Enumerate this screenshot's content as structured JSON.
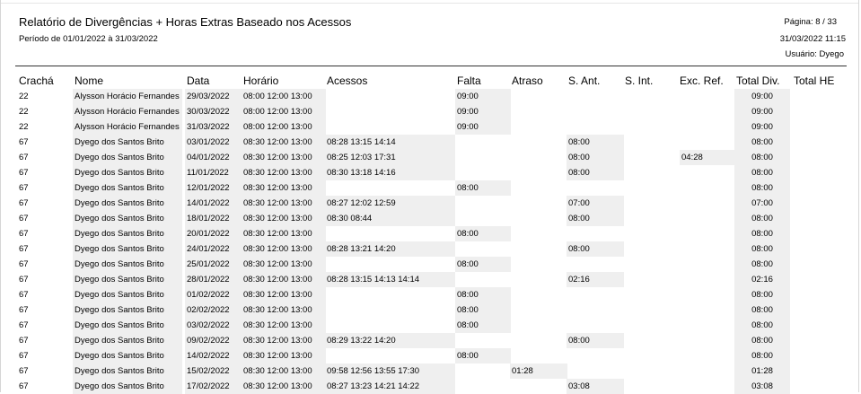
{
  "report": {
    "title": "Relatório de Divergências + Horas Extras Baseado nos Acessos",
    "period": "Período de 01/01/2022 à 31/03/2022",
    "page": "Página: 8 / 33",
    "datetime": "31/03/2022 11:15",
    "user": "Usuário: Dyego"
  },
  "columns": [
    "Crachá",
    "Nome",
    "Data",
    "Horário",
    "Acessos",
    "Falta",
    "Atraso",
    "S. Ant.",
    "S. Int.",
    "Exc. Ref.",
    "Total Div.",
    "Total HE"
  ],
  "rows": [
    {
      "cracha": "22",
      "nome": "Alysson Horácio Fernandes",
      "data": "29/03/2022",
      "horario": "08:00 12:00 13:00",
      "acessos": "",
      "falta": "09:00",
      "atraso": "",
      "sant": "",
      "sint": "",
      "excref": "",
      "totaldiv": "09:00",
      "totalhe": ""
    },
    {
      "cracha": "22",
      "nome": "Alysson Horácio Fernandes",
      "data": "30/03/2022",
      "horario": "08:00 12:00 13:00",
      "acessos": "",
      "falta": "09:00",
      "atraso": "",
      "sant": "",
      "sint": "",
      "excref": "",
      "totaldiv": "09:00",
      "totalhe": ""
    },
    {
      "cracha": "22",
      "nome": "Alysson Horácio Fernandes",
      "data": "31/03/2022",
      "horario": "08:00 12:00 13:00",
      "acessos": "",
      "falta": "09:00",
      "atraso": "",
      "sant": "",
      "sint": "",
      "excref": "",
      "totaldiv": "09:00",
      "totalhe": ""
    },
    {
      "cracha": "67",
      "nome": "Dyego dos Santos Brito",
      "data": "03/01/2022",
      "horario": "08:30 12:00 13:00",
      "acessos": "08:28 13:15 14:14",
      "falta": "",
      "atraso": "",
      "sant": "08:00",
      "sint": "",
      "excref": "",
      "totaldiv": "08:00",
      "totalhe": ""
    },
    {
      "cracha": "67",
      "nome": "Dyego dos Santos Brito",
      "data": "04/01/2022",
      "horario": "08:30 12:00 13:00",
      "acessos": "08:25 12:03 17:31",
      "falta": "",
      "atraso": "",
      "sant": "08:00",
      "sint": "",
      "excref": "04:28",
      "totaldiv": "08:00",
      "totalhe": ""
    },
    {
      "cracha": "67",
      "nome": "Dyego dos Santos Brito",
      "data": "11/01/2022",
      "horario": "08:30 12:00 13:00",
      "acessos": "08:30 13:18 14:16",
      "falta": "",
      "atraso": "",
      "sant": "08:00",
      "sint": "",
      "excref": "",
      "totaldiv": "08:00",
      "totalhe": ""
    },
    {
      "cracha": "67",
      "nome": "Dyego dos Santos Brito",
      "data": "12/01/2022",
      "horario": "08:30 12:00 13:00",
      "acessos": "",
      "falta": "08:00",
      "atraso": "",
      "sant": "",
      "sint": "",
      "excref": "",
      "totaldiv": "08:00",
      "totalhe": ""
    },
    {
      "cracha": "67",
      "nome": "Dyego dos Santos Brito",
      "data": "14/01/2022",
      "horario": "08:30 12:00 13:00",
      "acessos": "08:27 12:02 12:59",
      "falta": "",
      "atraso": "",
      "sant": "07:00",
      "sint": "",
      "excref": "",
      "totaldiv": "07:00",
      "totalhe": ""
    },
    {
      "cracha": "67",
      "nome": "Dyego dos Santos Brito",
      "data": "18/01/2022",
      "horario": "08:30 12:00 13:00",
      "acessos": "08:30  08:44",
      "falta": "",
      "atraso": "",
      "sant": "08:00",
      "sint": "",
      "excref": "",
      "totaldiv": "08:00",
      "totalhe": ""
    },
    {
      "cracha": "67",
      "nome": "Dyego dos Santos Brito",
      "data": "20/01/2022",
      "horario": "08:30 12:00 13:00",
      "acessos": "",
      "falta": "08:00",
      "atraso": "",
      "sant": "",
      "sint": "",
      "excref": "",
      "totaldiv": "08:00",
      "totalhe": ""
    },
    {
      "cracha": "67",
      "nome": "Dyego dos Santos Brito",
      "data": "24/01/2022",
      "horario": "08:30 12:00 13:00",
      "acessos": "08:28 13:21 14:20",
      "falta": "",
      "atraso": "",
      "sant": "08:00",
      "sint": "",
      "excref": "",
      "totaldiv": "08:00",
      "totalhe": ""
    },
    {
      "cracha": "67",
      "nome": "Dyego dos Santos Brito",
      "data": "25/01/2022",
      "horario": "08:30 12:00 13:00",
      "acessos": "",
      "falta": "08:00",
      "atraso": "",
      "sant": "",
      "sint": "",
      "excref": "",
      "totaldiv": "08:00",
      "totalhe": ""
    },
    {
      "cracha": "67",
      "nome": "Dyego dos Santos Brito",
      "data": "28/01/2022",
      "horario": "08:30 12:00 13:00",
      "acessos": "08:28 13:15 14:13 14:14",
      "falta": "",
      "atraso": "",
      "sant": "02:16",
      "sint": "",
      "excref": "",
      "totaldiv": "02:16",
      "totalhe": ""
    },
    {
      "cracha": "67",
      "nome": "Dyego dos Santos Brito",
      "data": "01/02/2022",
      "horario": "08:30 12:00 13:00",
      "acessos": "",
      "falta": "08:00",
      "atraso": "",
      "sant": "",
      "sint": "",
      "excref": "",
      "totaldiv": "08:00",
      "totalhe": ""
    },
    {
      "cracha": "67",
      "nome": "Dyego dos Santos Brito",
      "data": "02/02/2022",
      "horario": "08:30 12:00 13:00",
      "acessos": "",
      "falta": "08:00",
      "atraso": "",
      "sant": "",
      "sint": "",
      "excref": "",
      "totaldiv": "08:00",
      "totalhe": ""
    },
    {
      "cracha": "67",
      "nome": "Dyego dos Santos Brito",
      "data": "03/02/2022",
      "horario": "08:30 12:00 13:00",
      "acessos": "",
      "falta": "08:00",
      "atraso": "",
      "sant": "",
      "sint": "",
      "excref": "",
      "totaldiv": "08:00",
      "totalhe": ""
    },
    {
      "cracha": "67",
      "nome": "Dyego dos Santos Brito",
      "data": "09/02/2022",
      "horario": "08:30 12:00 13:00",
      "acessos": "08:29 13:22 14:20",
      "falta": "",
      "atraso": "",
      "sant": "08:00",
      "sint": "",
      "excref": "",
      "totaldiv": "08:00",
      "totalhe": ""
    },
    {
      "cracha": "67",
      "nome": "Dyego dos Santos Brito",
      "data": "14/02/2022",
      "horario": "08:30 12:00 13:00",
      "acessos": "",
      "falta": "08:00",
      "atraso": "",
      "sant": "",
      "sint": "",
      "excref": "",
      "totaldiv": "08:00",
      "totalhe": ""
    },
    {
      "cracha": "67",
      "nome": "Dyego dos Santos Brito",
      "data": "15/02/2022",
      "horario": "08:30 12:00 13:00",
      "acessos": "09:58 12:56 13:55 17:30",
      "falta": "",
      "atraso": "01:28",
      "sant": "",
      "sint": "",
      "excref": "",
      "totaldiv": "01:28",
      "totalhe": ""
    },
    {
      "cracha": "67",
      "nome": "Dyego dos Santos Brito",
      "data": "17/02/2022",
      "horario": "08:30 12:00 13:00",
      "acessos": "08:27 13:23 14:21 14:22",
      "falta": "",
      "atraso": "",
      "sant": "03:08",
      "sint": "",
      "excref": "",
      "totaldiv": "03:08",
      "totalhe": ""
    }
  ]
}
